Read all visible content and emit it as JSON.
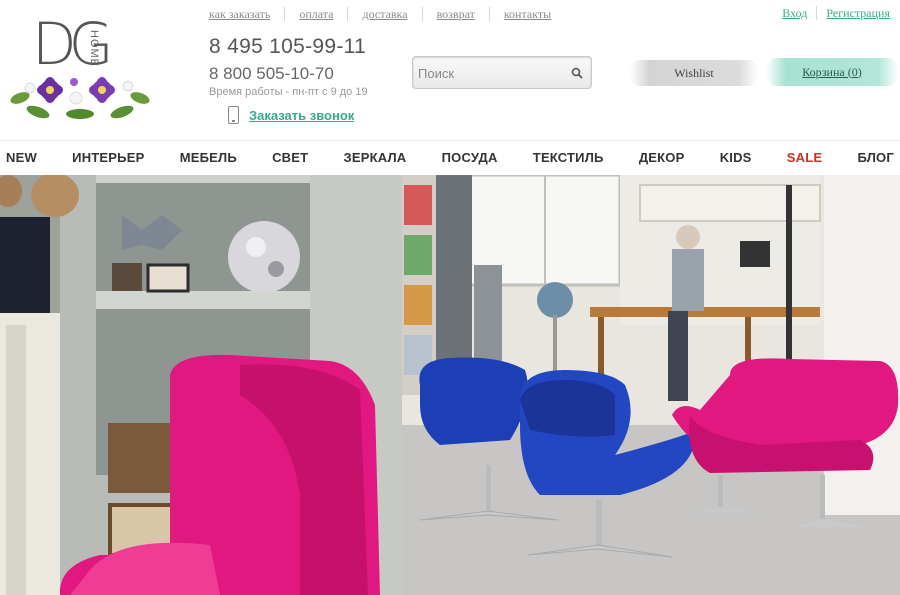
{
  "brand": {
    "logo_letters": "DG",
    "logo_sub": "HOME"
  },
  "top_nav": [
    {
      "label": "как заказать"
    },
    {
      "label": "оплата"
    },
    {
      "label": "доставка"
    },
    {
      "label": "возврат"
    },
    {
      "label": "контакты"
    }
  ],
  "account": {
    "login": "Вход",
    "register": "Регистрация"
  },
  "contacts": {
    "phone_main": "8 495 105-99-11",
    "phone_alt": "8 800 505-10-70",
    "hours": "Время работы - пн-пт с 9 до 19",
    "callback_label": "Заказать звонок"
  },
  "search": {
    "placeholder": "Поиск",
    "value": ""
  },
  "wishlist_label": "Wishlist",
  "cart_label": "Корзина (0)",
  "main_nav": [
    {
      "label": "NEW"
    },
    {
      "label": "ИНТЕРЬЕР"
    },
    {
      "label": "МЕБЕЛЬ"
    },
    {
      "label": "СВЕТ"
    },
    {
      "label": "ЗЕРКАЛА"
    },
    {
      "label": "ПОСУДА"
    },
    {
      "label": "ТЕКСТИЛЬ"
    },
    {
      "label": "ДЕКОР"
    },
    {
      "label": "KIDS"
    },
    {
      "label": "SALE"
    },
    {
      "label": "БЛОГ"
    }
  ],
  "colors": {
    "accent": "#3aa88c",
    "sale": "#d12c2c",
    "cart_bg": "#b2e6d9",
    "chair_pink": "#e0187f",
    "chair_blue": "#1d3fb5"
  }
}
